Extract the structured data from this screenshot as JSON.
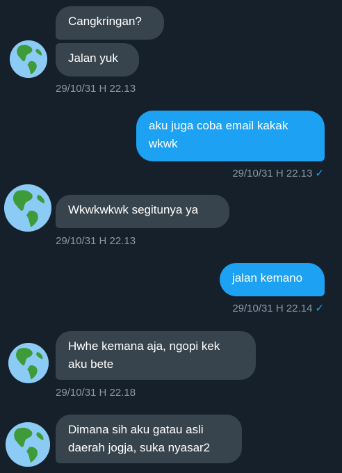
{
  "messages": [
    {
      "text": "Cangkringan?"
    },
    {
      "text": "Jalan yuk",
      "time": "29/10/31 H 22.13"
    },
    {
      "text": "aku juga coba email kakak\nwkwk",
      "time": "29/10/31 H 22.13",
      "status": "✓"
    },
    {
      "text": "Wkwkwkwk segitunya ya",
      "time": "29/10/31 H 22.13"
    },
    {
      "text": "jalan kemano",
      "time": "29/10/31 H 22.14",
      "status": "✓"
    },
    {
      "text": "Hwhe kemana aja, ngopi kek\naku bete",
      "time": "29/10/31 H 22.18"
    },
    {
      "text": "Dimana sih aku gatau asli\ndaerah jogja, suka nyasar2"
    }
  ],
  "colors": {
    "background": "#15202b",
    "received": "#38444d",
    "sent": "#1da1f2",
    "meta": "#8899a6"
  },
  "icons": {
    "avatar": "globe-earth-emoji",
    "read_receipt": "check-icon"
  }
}
